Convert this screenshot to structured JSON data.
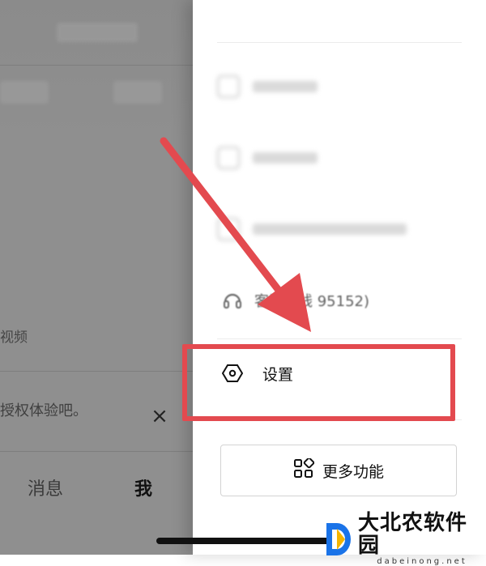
{
  "left_panel": {
    "video_label": "视频",
    "auth_prompt": "授权体验吧。",
    "close_glyph": "×",
    "tabs": [
      {
        "label": "消息",
        "active": false
      },
      {
        "label": "我",
        "active": true
      }
    ]
  },
  "drawer": {
    "customer_service_label": "客服热线 95152)",
    "settings_label": "设置",
    "more_features_label": "更多功能"
  },
  "annotation": {
    "highlight_color": "#e34a4f",
    "arrow_color": "#e34a4f"
  },
  "watermark": {
    "title": "大北农软件园",
    "subtitle": "dabeinong.net"
  }
}
